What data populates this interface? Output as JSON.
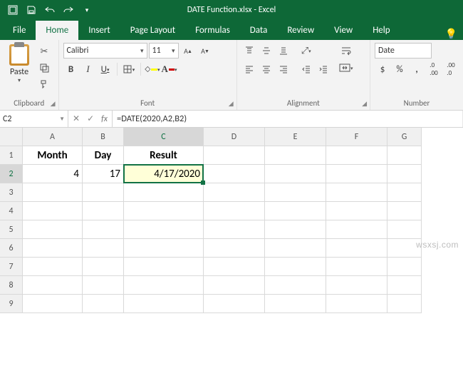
{
  "title": "DATE Function.xlsx - Excel",
  "tabs": {
    "file": "File",
    "home": "Home",
    "insert": "Insert",
    "page_layout": "Page Layout",
    "formulas": "Formulas",
    "data": "Data",
    "review": "Review",
    "view": "View",
    "help": "Help"
  },
  "clipboard": {
    "label": "Clipboard",
    "paste": "Paste"
  },
  "font": {
    "label": "Font",
    "name": "Calibri",
    "size": "11",
    "bold": "B",
    "italic": "I",
    "underline": "U",
    "inc": "A▲",
    "dec": "A▼"
  },
  "alignment": {
    "label": "Alignment"
  },
  "number": {
    "label": "Number",
    "format": "Date",
    "currency": "$",
    "percent": "%",
    "comma": ",",
    "dec_inc": ".0→.00",
    "dec_dec": ".00→.0"
  },
  "namebox": "C2",
  "formula": "=DATE(2020,A2,B2)",
  "columns": [
    "A",
    "B",
    "C",
    "D",
    "E",
    "F",
    "G"
  ],
  "rows": [
    "1",
    "2",
    "3",
    "4",
    "5",
    "6",
    "7",
    "8",
    "9"
  ],
  "headers": {
    "a": "Month",
    "b": "Day",
    "c": "Result"
  },
  "data": {
    "a2": "4",
    "b2": "17",
    "c2": "4/17/2020"
  },
  "watermark": "wsxsj.com"
}
